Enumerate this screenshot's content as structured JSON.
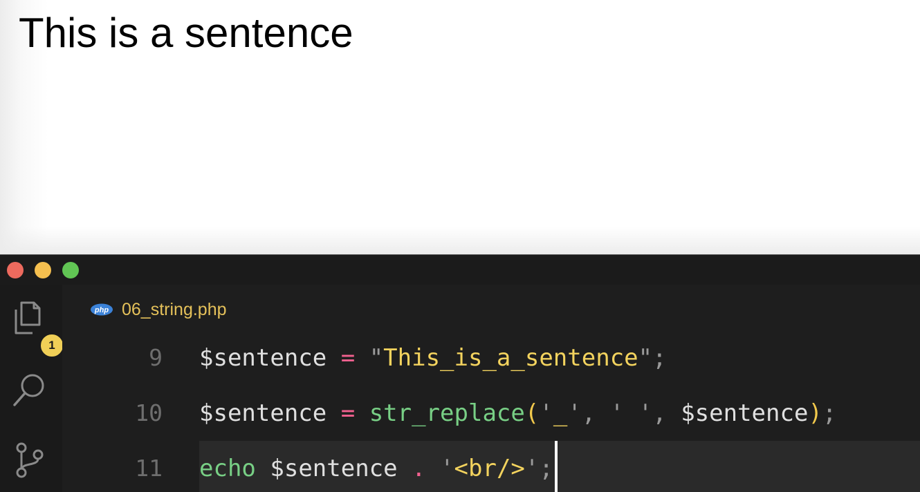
{
  "browser": {
    "output_text": "This is a sentence"
  },
  "editor": {
    "window_controls": [
      "close",
      "minimize",
      "maximize"
    ],
    "activity_bar": {
      "explorer": {
        "icon": "files-icon",
        "badge": "1"
      },
      "search": {
        "icon": "search-icon"
      },
      "source_control": {
        "icon": "source-control-icon"
      }
    },
    "tab": {
      "icon_text": "php",
      "file_name": "06_string.php"
    },
    "lines": [
      {
        "number": "9",
        "tokens": [
          {
            "t": "$sentence",
            "c": "var"
          },
          {
            "t": " ",
            "c": "ws"
          },
          {
            "t": "=",
            "c": "op"
          },
          {
            "t": " ",
            "c": "ws"
          },
          {
            "t": "\"",
            "c": "punc"
          },
          {
            "t": "This_is_a_sentence",
            "c": "str"
          },
          {
            "t": "\"",
            "c": "punc"
          },
          {
            "t": ";",
            "c": "punc"
          }
        ]
      },
      {
        "number": "10",
        "tokens": [
          {
            "t": "$sentence",
            "c": "var"
          },
          {
            "t": " ",
            "c": "ws"
          },
          {
            "t": "=",
            "c": "op"
          },
          {
            "t": " ",
            "c": "ws"
          },
          {
            "t": "str_replace",
            "c": "fn"
          },
          {
            "t": "(",
            "c": "paren"
          },
          {
            "t": "'",
            "c": "punc"
          },
          {
            "t": "_",
            "c": "str"
          },
          {
            "t": "'",
            "c": "punc"
          },
          {
            "t": ",",
            "c": "punc"
          },
          {
            "t": " ",
            "c": "ws"
          },
          {
            "t": "'",
            "c": "punc"
          },
          {
            "t": " ",
            "c": "str"
          },
          {
            "t": "'",
            "c": "punc"
          },
          {
            "t": ",",
            "c": "punc"
          },
          {
            "t": " ",
            "c": "ws"
          },
          {
            "t": "$sentence",
            "c": "var"
          },
          {
            "t": ")",
            "c": "paren"
          },
          {
            "t": ";",
            "c": "punc"
          }
        ]
      },
      {
        "number": "11",
        "active": true,
        "tokens": [
          {
            "t": "echo",
            "c": "kw"
          },
          {
            "t": " ",
            "c": "ws"
          },
          {
            "t": "$sentence",
            "c": "var"
          },
          {
            "t": " ",
            "c": "ws"
          },
          {
            "t": ".",
            "c": "op"
          },
          {
            "t": " ",
            "c": "ws"
          },
          {
            "t": "'",
            "c": "punc"
          },
          {
            "t": "<br/>",
            "c": "str"
          },
          {
            "t": "'",
            "c": "punc"
          },
          {
            "t": ";",
            "c": "punc"
          }
        ]
      }
    ]
  },
  "colors": {
    "editor_bg": "#1e1e1e",
    "variable": "#e0e0e0",
    "operator": "#f2618f",
    "string": "#f3d35e",
    "function": "#78cf85",
    "keyword": "#78cf85",
    "punctuation": "#9a9a9a",
    "file_name": "#e5c15a",
    "badge": "#f0cf57",
    "close": "#ed6a5e",
    "minimize": "#f5bf4f",
    "maximize": "#61c554"
  }
}
